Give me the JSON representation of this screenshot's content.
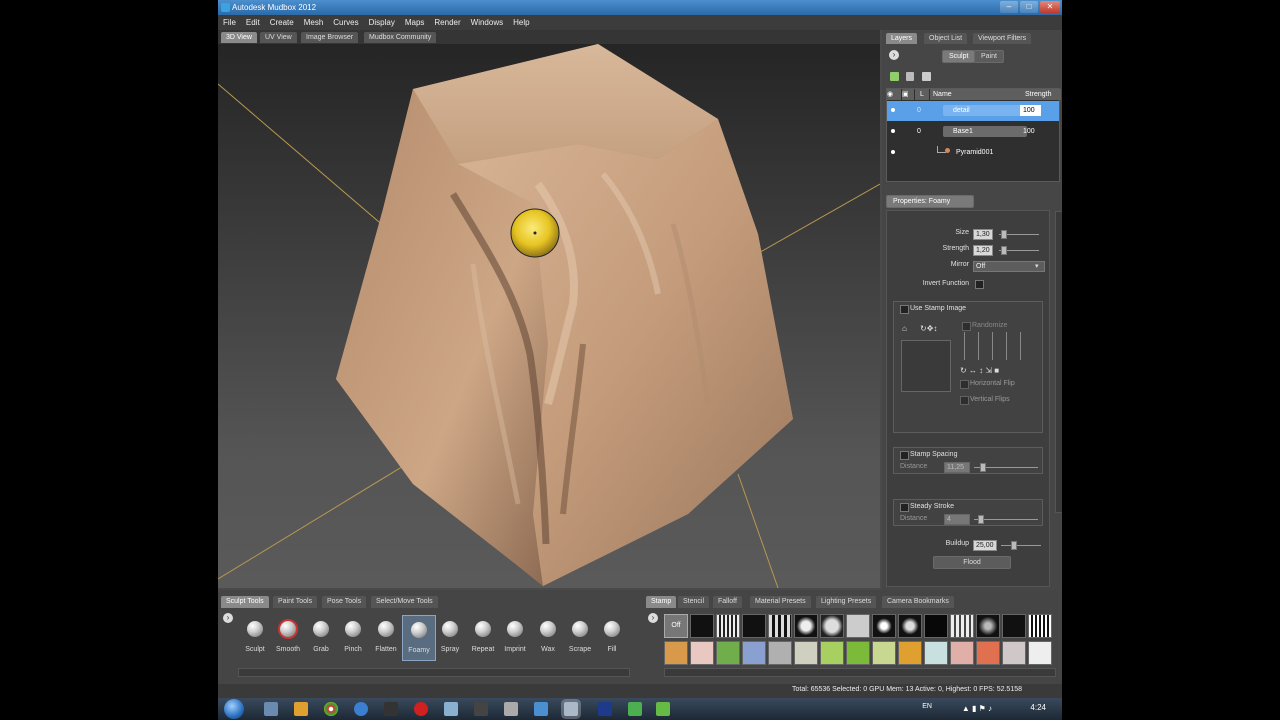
{
  "window": {
    "title": "Autodesk Mudbox 2012"
  },
  "menu": [
    "File",
    "Edit",
    "Create",
    "Mesh",
    "Curves",
    "Display",
    "Maps",
    "Render",
    "Windows",
    "Help"
  ],
  "view_tabs": [
    "3D View",
    "UV View",
    "Image Browser",
    "Mudbox Community"
  ],
  "right_tabs": [
    "Layers",
    "Object List",
    "Viewport Filters"
  ],
  "layer_modes": [
    "Sculpt",
    "Paint"
  ],
  "layers_table": {
    "headers": {
      "l": "L",
      "name": "Name",
      "strength": "Strength"
    },
    "rows": [
      {
        "name": "detail",
        "level": "0",
        "strength": "100"
      },
      {
        "name": "Base1",
        "level": "0",
        "strength": "100"
      },
      {
        "name": "Pyramid001",
        "level": "",
        "strength": ""
      }
    ]
  },
  "properties": {
    "title": "Properties: Foamy",
    "size_label": "Size",
    "size_value": "1,30",
    "strength_label": "Strength",
    "strength_value": "1,20",
    "mirror_label": "Mirror",
    "mirror_value": "Off",
    "invert_label": "Invert Function",
    "use_stamp_label": "Use Stamp Image",
    "randomize_label": "Randomize",
    "hflip_label": "Horizontal Flip",
    "vflip_label": "Vertical Flips",
    "stamp_spacing_label": "Stamp Spacing",
    "distance_label": "Distance",
    "distance_value": "11,25",
    "steady_label": "Steady Stroke",
    "steady_distance_label": "Distance",
    "steady_distance_value": "4",
    "buildup_label": "Buildup",
    "buildup_value": "25,00",
    "flood_label": "Flood"
  },
  "tool_tabs": [
    "Sculpt Tools",
    "Paint Tools",
    "Pose Tools",
    "Select/Move Tools"
  ],
  "tools": [
    "Sculpt",
    "Smooth",
    "Grab",
    "Pinch",
    "Flatten",
    "Foamy",
    "Spray",
    "Repeat",
    "Imprint",
    "Wax",
    "Scrape",
    "Fill"
  ],
  "stamp_tabs": [
    "Stamp",
    "Stencil",
    "Falloff",
    "Material Presets",
    "Lighting Presets",
    "Camera Bookmarks"
  ],
  "stamp_off_label": "Off",
  "status": "Total: 65536  Selected: 0 GPU Mem: 13  Active: 0, Highest: 0  FPS: 52.5158",
  "taskbar": {
    "lang": "EN",
    "clock": "4:24"
  },
  "colors": {
    "accent": "#5aa0e8",
    "brush": "#f0d020",
    "mesh": "#c9a283"
  }
}
